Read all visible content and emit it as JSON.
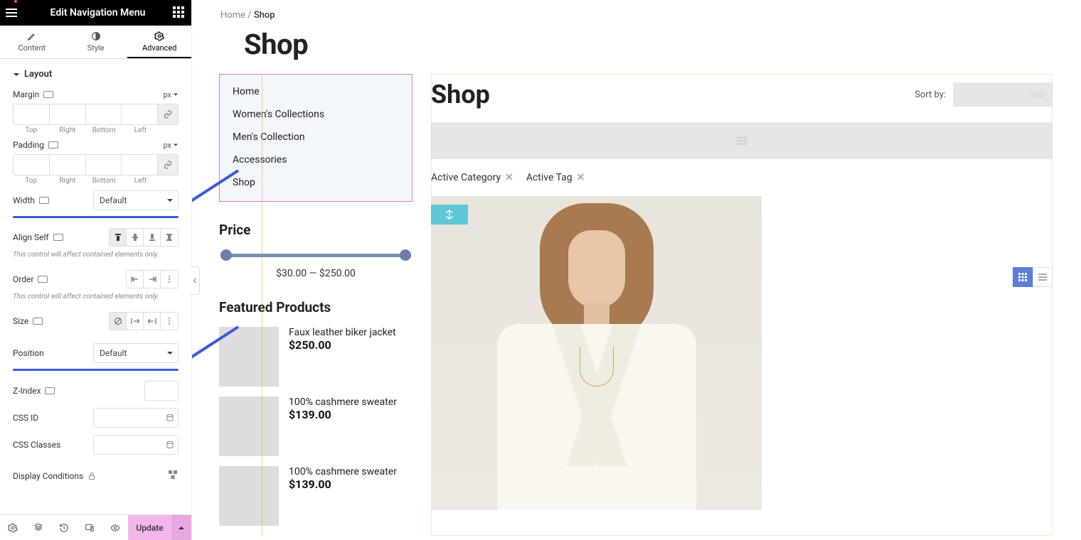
{
  "panel": {
    "title": "Edit Navigation Menu",
    "tabs": {
      "content": "Content",
      "style": "Style",
      "advanced": "Advanced",
      "active": "advanced"
    },
    "section": "Layout",
    "margin_label": "Margin",
    "padding_label": "Padding",
    "unit": "px",
    "sides": {
      "top": "Top",
      "right": "Right",
      "bottom": "Bottom",
      "left": "Left"
    },
    "width_label": "Width",
    "width_value": "Default",
    "align_self_label": "Align Self",
    "hint": "This control will affect contained elements only.",
    "order_label": "Order",
    "size_label": "Size",
    "position_label": "Position",
    "position_value": "Default",
    "zindex_label": "Z-Index",
    "cssid_label": "CSS ID",
    "cssclasses_label": "CSS Classes",
    "display_conditions_label": "Display Conditions",
    "update_label": "Update"
  },
  "breadcrumb": {
    "home": "Home",
    "sep": "/",
    "current": "Shop"
  },
  "page_title": "Shop",
  "nav_items": [
    "Home",
    "Women's Collections",
    "Men's Collection",
    "Accessories",
    "Shop"
  ],
  "price_widget": {
    "title": "Price",
    "range": "$30.00 — $250.00"
  },
  "featured": {
    "title": "Featured Products",
    "items": [
      {
        "name": "Faux leather biker jacket",
        "price": "$250.00",
        "thumb": "th-yellow"
      },
      {
        "name": "100% cashmere sweater",
        "price": "$139.00",
        "thumb": "th-pink"
      },
      {
        "name": "100% cashmere sweater",
        "price": "$139.00",
        "thumb": "th-beige"
      }
    ]
  },
  "shop": {
    "title": "Shop",
    "sort_label": "Sort by:",
    "active_category": "Active Category",
    "active_tag": "Active Tag"
  }
}
